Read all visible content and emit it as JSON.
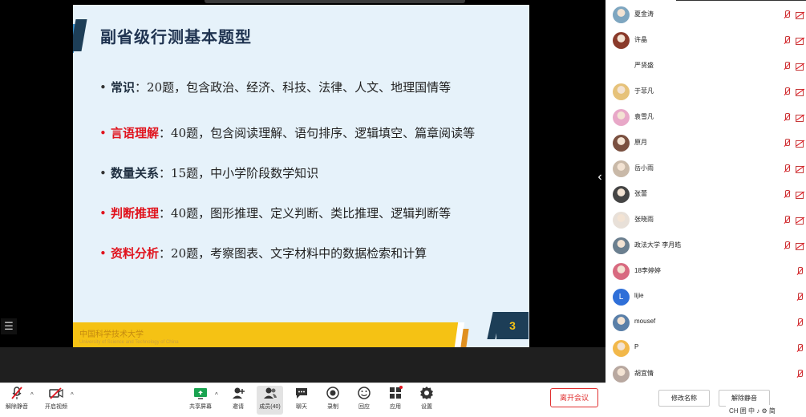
{
  "slide": {
    "title": "副省级行测基本题型",
    "bullets": [
      {
        "term": "常识",
        "sep": "：",
        "text": "20题，包含政治、经济、科技、法律、人文、地理国情等",
        "red": false
      },
      {
        "term": "言语理解",
        "sep": "：",
        "text": "40题，包含阅读理解、语句排序、逻辑填空、篇章阅读等",
        "red": true
      },
      {
        "term": "数量关系",
        "sep": "：",
        "text": "15题，中小学阶段数学知识",
        "red": false
      },
      {
        "term": "判断推理",
        "sep": "：",
        "text": "40题，图形推理、定义判断、类比推理、逻辑判断等",
        "red": true
      },
      {
        "term": "资料分析",
        "sep": "：",
        "text": "20题，考察图表、文字材料中的数据检索和计算",
        "red": true
      }
    ],
    "bullet_glyph": "•",
    "page_number": "3",
    "logo_text": "中国科学技术大学",
    "logo_subtext": "University of Science and Technology of China"
  },
  "participants": [
    {
      "name": "夏金涛",
      "avatar": "photo",
      "color": "#7ea6c0",
      "initial": "",
      "muted": true,
      "camera_off": true
    },
    {
      "name": "许晶",
      "avatar": "photo",
      "color": "#8a3a2a",
      "initial": "",
      "muted": true,
      "camera_off": true
    },
    {
      "name": "严贤盛",
      "avatar": "none",
      "color": "#ffffff",
      "initial": "",
      "muted": true,
      "camera_off": true
    },
    {
      "name": "于菲凡",
      "avatar": "photo",
      "color": "#e6c27a",
      "initial": "",
      "muted": true,
      "camera_off": true
    },
    {
      "name": "袁雪凡",
      "avatar": "photo",
      "color": "#e8a8c8",
      "initial": "",
      "muted": true,
      "camera_off": true
    },
    {
      "name": "原月",
      "avatar": "photo",
      "color": "#7a5040",
      "initial": "",
      "muted": true,
      "camera_off": true
    },
    {
      "name": "岳小雨",
      "avatar": "photo",
      "color": "#c9b9a8",
      "initial": "",
      "muted": true,
      "camera_off": true
    },
    {
      "name": "张蕾",
      "avatar": "photo",
      "color": "#444444",
      "initial": "",
      "muted": true,
      "camera_off": true
    },
    {
      "name": "张晓雨",
      "avatar": "photo",
      "color": "#e8e0d8",
      "initial": "",
      "muted": true,
      "camera_off": true
    },
    {
      "name": "政法大学 李月皓",
      "avatar": "photo",
      "color": "#6b7f8f",
      "initial": "",
      "muted": true,
      "camera_off": true
    },
    {
      "name": "18李婷婷",
      "avatar": "photo",
      "color": "#d86a80",
      "initial": "",
      "muted": true,
      "camera_off": false
    },
    {
      "name": "lijie",
      "avatar": "initial",
      "color": "#2f6fd8",
      "initial": "L",
      "muted": true,
      "camera_off": false
    },
    {
      "name": "mousef",
      "avatar": "photo",
      "color": "#5a7fa8",
      "initial": "",
      "muted": true,
      "camera_off": false
    },
    {
      "name": "P",
      "avatar": "photo",
      "color": "#f2b84a",
      "initial": "",
      "muted": true,
      "camera_off": false
    },
    {
      "name": "胡宜情",
      "avatar": "photo",
      "color": "#b8a8a0",
      "initial": "",
      "muted": true,
      "camera_off": false
    }
  ],
  "panel_buttons": {
    "rename": "修改名称",
    "unmute_self": "解除静音"
  },
  "system_tray": "CH 囲 中 ♪ ⚙ 简",
  "toolbar": {
    "unmute": "解除静音",
    "start_video": "开启视频",
    "share_screen": "共享屏幕",
    "invite": "邀请",
    "members": "成员(40)",
    "chat": "聊天",
    "record": "录制",
    "replay": "回应",
    "apps": "应用",
    "settings": "设置",
    "leave": "离开会议"
  },
  "colors": {
    "slide_bg": "#e6f2fa",
    "title": "#1f3350",
    "red_term": "#e0141e",
    "footer_yellow": "#f5c214",
    "badge": "#1d3e57",
    "mute_red": "#e0141e",
    "leave_red": "#e03030"
  }
}
